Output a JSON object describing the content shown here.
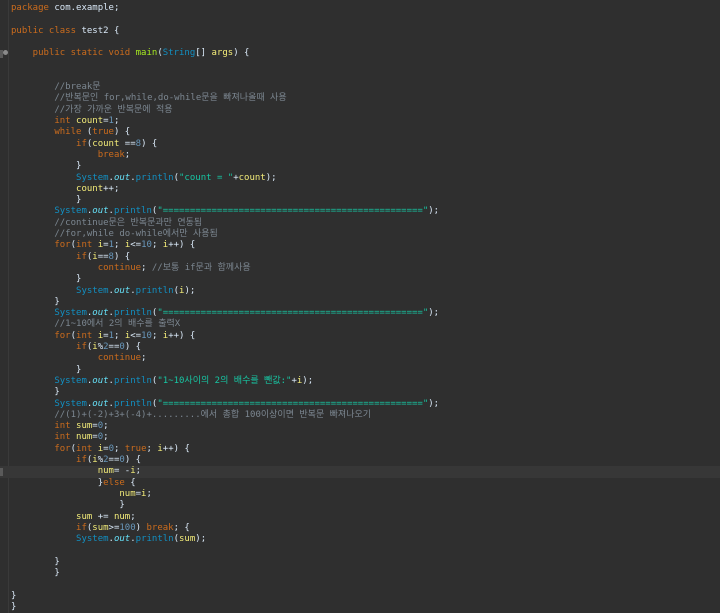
{
  "editor": {
    "lines": [
      [
        {
          "t": "package",
          "c": "kw"
        },
        {
          "t": " com.example;",
          "c": "pl"
        }
      ],
      [],
      [
        {
          "t": "public class ",
          "c": "kw"
        },
        {
          "t": "test2",
          "c": "pl"
        },
        {
          "t": " {",
          "c": "pl"
        }
      ],
      [],
      [
        {
          "t": "    public static void ",
          "c": "kw"
        },
        {
          "t": "main",
          "c": "mth"
        },
        {
          "t": "(",
          "c": "pl"
        },
        {
          "t": "String",
          "c": "cls"
        },
        {
          "t": "[] ",
          "c": "pl"
        },
        {
          "t": "args",
          "c": "var"
        },
        {
          "t": ") {",
          "c": "pl"
        }
      ],
      [],
      [],
      [
        {
          "t": "        //break문",
          "c": "cm"
        }
      ],
      [
        {
          "t": "        //반복문인 for,while,do-while문을 빠져나올때 사용",
          "c": "cm"
        }
      ],
      [
        {
          "t": "        //가장 가까운 반복문에 적용",
          "c": "cm"
        }
      ],
      [
        {
          "t": "        int ",
          "c": "kw"
        },
        {
          "t": "count",
          "c": "var"
        },
        {
          "t": "=",
          "c": "pl"
        },
        {
          "t": "1",
          "c": "num"
        },
        {
          "t": ";",
          "c": "pl"
        }
      ],
      [
        {
          "t": "        while ",
          "c": "kw"
        },
        {
          "t": "(",
          "c": "pl"
        },
        {
          "t": "true",
          "c": "kw"
        },
        {
          "t": ") {",
          "c": "pl"
        }
      ],
      [
        {
          "t": "            if",
          "c": "kw"
        },
        {
          "t": "(",
          "c": "pl"
        },
        {
          "t": "count",
          "c": "var"
        },
        {
          "t": " ==",
          "c": "pl"
        },
        {
          "t": "8",
          "c": "num"
        },
        {
          "t": ") {",
          "c": "pl"
        }
      ],
      [
        {
          "t": "                break",
          "c": "kw"
        },
        {
          "t": ";",
          "c": "pl"
        }
      ],
      [
        {
          "t": "            }",
          "c": "pl"
        }
      ],
      [
        {
          "t": "            System",
          "c": "cls"
        },
        {
          "t": ".",
          "c": "pl"
        },
        {
          "t": "out",
          "c": "fld"
        },
        {
          "t": ".",
          "c": "pl"
        },
        {
          "t": "println",
          "c": "cls"
        },
        {
          "t": "(",
          "c": "pl"
        },
        {
          "t": "\"count = \"",
          "c": "str"
        },
        {
          "t": "+",
          "c": "pl"
        },
        {
          "t": "count",
          "c": "var"
        },
        {
          "t": ");",
          "c": "pl"
        }
      ],
      [
        {
          "t": "            count",
          "c": "var"
        },
        {
          "t": "++;",
          "c": "pl"
        }
      ],
      [
        {
          "t": "            }",
          "c": "pl"
        }
      ],
      [
        {
          "t": "        System",
          "c": "cls"
        },
        {
          "t": ".",
          "c": "pl"
        },
        {
          "t": "out",
          "c": "fld"
        },
        {
          "t": ".",
          "c": "pl"
        },
        {
          "t": "println",
          "c": "cls"
        },
        {
          "t": "(",
          "c": "pl"
        },
        {
          "t": "\"================================================\"",
          "c": "str"
        },
        {
          "t": ");",
          "c": "pl"
        }
      ],
      [
        {
          "t": "        //continue문은 반복문과만 연동됨",
          "c": "cm"
        }
      ],
      [
        {
          "t": "        //for,while do-while에서만 사용됨",
          "c": "cm"
        }
      ],
      [
        {
          "t": "        for",
          "c": "kw"
        },
        {
          "t": "(",
          "c": "pl"
        },
        {
          "t": "int ",
          "c": "kw"
        },
        {
          "t": "i",
          "c": "var"
        },
        {
          "t": "=",
          "c": "pl"
        },
        {
          "t": "1",
          "c": "num"
        },
        {
          "t": "; ",
          "c": "pl"
        },
        {
          "t": "i",
          "c": "var"
        },
        {
          "t": "<=",
          "c": "pl"
        },
        {
          "t": "10",
          "c": "num"
        },
        {
          "t": "; ",
          "c": "pl"
        },
        {
          "t": "i",
          "c": "var"
        },
        {
          "t": "++) {",
          "c": "pl"
        }
      ],
      [
        {
          "t": "            if",
          "c": "kw"
        },
        {
          "t": "(",
          "c": "pl"
        },
        {
          "t": "i",
          "c": "var"
        },
        {
          "t": "==",
          "c": "pl"
        },
        {
          "t": "8",
          "c": "num"
        },
        {
          "t": ") {",
          "c": "pl"
        }
      ],
      [
        {
          "t": "                continue",
          "c": "kw"
        },
        {
          "t": "; ",
          "c": "pl"
        },
        {
          "t": "//보통 if문과 함께사용",
          "c": "cm"
        }
      ],
      [
        {
          "t": "            }",
          "c": "pl"
        }
      ],
      [
        {
          "t": "            System",
          "c": "cls"
        },
        {
          "t": ".",
          "c": "pl"
        },
        {
          "t": "out",
          "c": "fld"
        },
        {
          "t": ".",
          "c": "pl"
        },
        {
          "t": "println",
          "c": "cls"
        },
        {
          "t": "(",
          "c": "pl"
        },
        {
          "t": "i",
          "c": "var"
        },
        {
          "t": ");",
          "c": "pl"
        }
      ],
      [
        {
          "t": "        }",
          "c": "pl"
        }
      ],
      [
        {
          "t": "        System",
          "c": "cls"
        },
        {
          "t": ".",
          "c": "pl"
        },
        {
          "t": "out",
          "c": "fld"
        },
        {
          "t": ".",
          "c": "pl"
        },
        {
          "t": "println",
          "c": "cls"
        },
        {
          "t": "(",
          "c": "pl"
        },
        {
          "t": "\"================================================\"",
          "c": "str"
        },
        {
          "t": ");",
          "c": "pl"
        }
      ],
      [
        {
          "t": "        //1~10에서 2의 배수를 출력X",
          "c": "cm"
        }
      ],
      [
        {
          "t": "        for",
          "c": "kw"
        },
        {
          "t": "(",
          "c": "pl"
        },
        {
          "t": "int ",
          "c": "kw"
        },
        {
          "t": "i",
          "c": "var"
        },
        {
          "t": "=",
          "c": "pl"
        },
        {
          "t": "1",
          "c": "num"
        },
        {
          "t": "; ",
          "c": "pl"
        },
        {
          "t": "i",
          "c": "var"
        },
        {
          "t": "<=",
          "c": "pl"
        },
        {
          "t": "10",
          "c": "num"
        },
        {
          "t": "; ",
          "c": "pl"
        },
        {
          "t": "i",
          "c": "var"
        },
        {
          "t": "++) {",
          "c": "pl"
        }
      ],
      [
        {
          "t": "            if",
          "c": "kw"
        },
        {
          "t": "(",
          "c": "pl"
        },
        {
          "t": "i",
          "c": "var"
        },
        {
          "t": "%",
          "c": "pl"
        },
        {
          "t": "2",
          "c": "num"
        },
        {
          "t": "==",
          "c": "pl"
        },
        {
          "t": "0",
          "c": "num"
        },
        {
          "t": ") {",
          "c": "pl"
        }
      ],
      [
        {
          "t": "                continue",
          "c": "kw"
        },
        {
          "t": ";",
          "c": "pl"
        }
      ],
      [
        {
          "t": "            }",
          "c": "pl"
        }
      ],
      [
        {
          "t": "        System",
          "c": "cls"
        },
        {
          "t": ".",
          "c": "pl"
        },
        {
          "t": "out",
          "c": "fld"
        },
        {
          "t": ".",
          "c": "pl"
        },
        {
          "t": "println",
          "c": "cls"
        },
        {
          "t": "(",
          "c": "pl"
        },
        {
          "t": "\"1~10사이의 2의 배수를 뺀값:\"",
          "c": "str"
        },
        {
          "t": "+",
          "c": "pl"
        },
        {
          "t": "i",
          "c": "var"
        },
        {
          "t": ");",
          "c": "pl"
        }
      ],
      [
        {
          "t": "        }",
          "c": "pl"
        }
      ],
      [
        {
          "t": "        System",
          "c": "cls"
        },
        {
          "t": ".",
          "c": "pl"
        },
        {
          "t": "out",
          "c": "fld"
        },
        {
          "t": ".",
          "c": "pl"
        },
        {
          "t": "println",
          "c": "cls"
        },
        {
          "t": "(",
          "c": "pl"
        },
        {
          "t": "\"================================================\"",
          "c": "str"
        },
        {
          "t": ");",
          "c": "pl"
        }
      ],
      [
        {
          "t": "        //(1)+(-2)+3+(-4)+.........에서 총합 100이상이면 반복문 빠져나오기",
          "c": "cm"
        }
      ],
      [
        {
          "t": "        int ",
          "c": "kw"
        },
        {
          "t": "sum",
          "c": "var"
        },
        {
          "t": "=",
          "c": "pl"
        },
        {
          "t": "0",
          "c": "num"
        },
        {
          "t": ";",
          "c": "pl"
        }
      ],
      [
        {
          "t": "        int ",
          "c": "kw"
        },
        {
          "t": "num",
          "c": "var"
        },
        {
          "t": "=",
          "c": "pl"
        },
        {
          "t": "0",
          "c": "num"
        },
        {
          "t": ";",
          "c": "pl"
        }
      ],
      [
        {
          "t": "        for",
          "c": "kw"
        },
        {
          "t": "(",
          "c": "pl"
        },
        {
          "t": "int ",
          "c": "kw"
        },
        {
          "t": "i",
          "c": "var"
        },
        {
          "t": "=",
          "c": "pl"
        },
        {
          "t": "0",
          "c": "num"
        },
        {
          "t": "; ",
          "c": "pl"
        },
        {
          "t": "true",
          "c": "kw"
        },
        {
          "t": "; ",
          "c": "pl"
        },
        {
          "t": "i",
          "c": "var"
        },
        {
          "t": "++) {",
          "c": "pl"
        }
      ],
      [
        {
          "t": "            if",
          "c": "kw"
        },
        {
          "t": "(",
          "c": "pl"
        },
        {
          "t": "i",
          "c": "var"
        },
        {
          "t": "%",
          "c": "pl"
        },
        {
          "t": "2",
          "c": "num"
        },
        {
          "t": "==",
          "c": "pl"
        },
        {
          "t": "0",
          "c": "num"
        },
        {
          "t": ") {",
          "c": "pl"
        }
      ],
      [
        {
          "t": "                num",
          "c": "var"
        },
        {
          "t": "= -",
          "c": "pl"
        },
        {
          "t": "i",
          "c": "var"
        },
        {
          "t": ";",
          "c": "pl"
        }
      ],
      [
        {
          "t": "                }",
          "c": "pl"
        },
        {
          "t": "else",
          "c": "kw"
        },
        {
          "t": " {",
          "c": "pl"
        }
      ],
      [
        {
          "t": "                    num",
          "c": "var"
        },
        {
          "t": "=",
          "c": "pl"
        },
        {
          "t": "i",
          "c": "var"
        },
        {
          "t": ";",
          "c": "pl"
        }
      ],
      [
        {
          "t": "                    }",
          "c": "pl"
        }
      ],
      [
        {
          "t": "            sum",
          "c": "var"
        },
        {
          "t": " += ",
          "c": "pl"
        },
        {
          "t": "num",
          "c": "var"
        },
        {
          "t": ";",
          "c": "pl"
        }
      ],
      [
        {
          "t": "            if",
          "c": "kw"
        },
        {
          "t": "(",
          "c": "pl"
        },
        {
          "t": "sum",
          "c": "var"
        },
        {
          "t": ">=",
          "c": "pl"
        },
        {
          "t": "100",
          "c": "num"
        },
        {
          "t": ") ",
          "c": "pl"
        },
        {
          "t": "break",
          "c": "kw"
        },
        {
          "t": "; {",
          "c": "pl"
        }
      ],
      [
        {
          "t": "            System",
          "c": "cls"
        },
        {
          "t": ".",
          "c": "pl"
        },
        {
          "t": "out",
          "c": "fld"
        },
        {
          "t": ".",
          "c": "pl"
        },
        {
          "t": "println",
          "c": "cls"
        },
        {
          "t": "(",
          "c": "pl"
        },
        {
          "t": "sum",
          "c": "var"
        },
        {
          "t": ");",
          "c": "pl"
        }
      ],
      [],
      [
        {
          "t": "        }",
          "c": "pl"
        }
      ],
      [
        {
          "t": "        }",
          "c": "pl"
        }
      ],
      [],
      [
        {
          "t": "}",
          "c": "pl"
        }
      ],
      [
        {
          "t": "}",
          "c": "pl"
        }
      ]
    ],
    "current_line": 41,
    "gutter_marks": [
      4,
      41
    ]
  }
}
